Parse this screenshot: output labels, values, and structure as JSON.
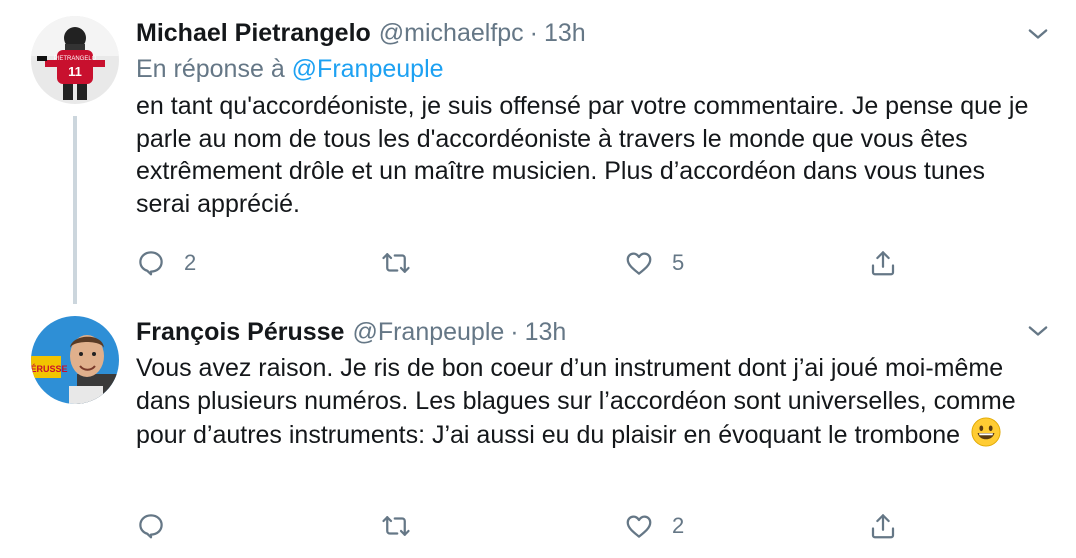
{
  "tweets": [
    {
      "name": "Michael Pietrangelo",
      "handle": "@michaelfpc",
      "separator": "·",
      "time": "13h",
      "reply_prefix": "En réponse à",
      "reply_mention": "@Franpeuple",
      "text": "en tant qu'accordéoniste, je suis offensé par votre commentaire. Je pense que je parle au nom de tous les d'accordéoniste à travers le monde que vous êtes extrêmement drôle et un maître musicien. Plus d’accordéon dans vous tunes serai apprécié.",
      "replies": "2",
      "retweets": "",
      "likes": "5",
      "avatar_icon": "hockey-player-avatar"
    },
    {
      "name": "François Pérusse",
      "handle": "@Franpeuple",
      "separator": "·",
      "time": "13h",
      "text": "Vous avez raison. Je ris de bon coeur d’un instrument dont j’ai joué moi-même dans plusieurs numéros. Les blagues sur l’accordéon sont universelles, comme pour d’autres instruments: J’ai aussi eu du plaisir en évoquant le trombone",
      "emoji": "grinning-face",
      "replies": "",
      "retweets": "",
      "likes": "2",
      "avatar_icon": "man-portrait-avatar"
    }
  ],
  "colors": {
    "text": "#14171a",
    "secondary": "#657786",
    "link": "#1da1f2",
    "thread_line": "#ccd6dd"
  }
}
